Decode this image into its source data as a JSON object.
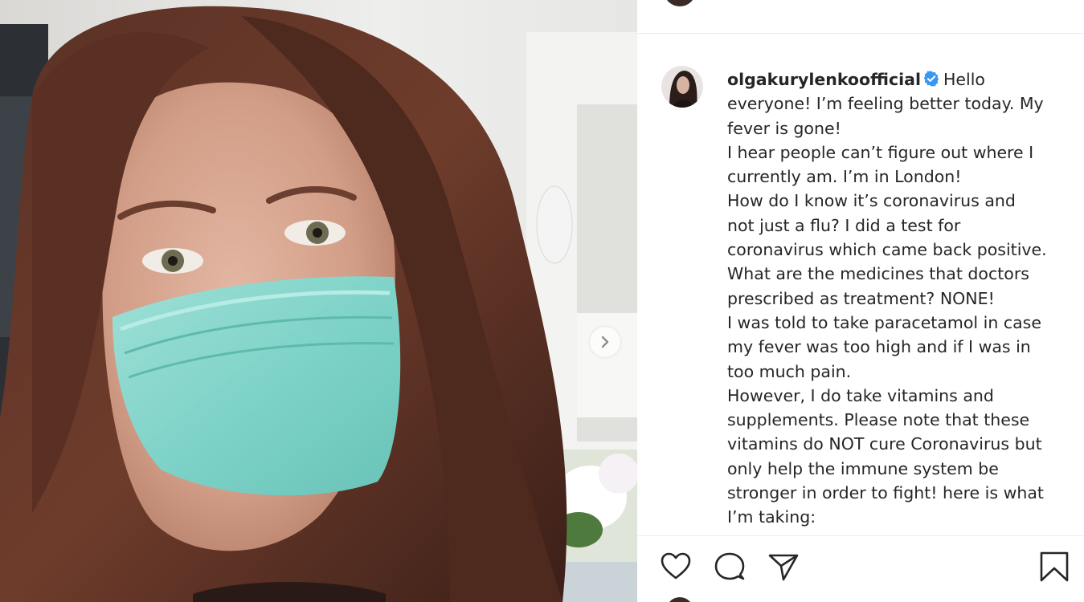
{
  "post": {
    "username": "olgakurylenkoofficial",
    "verified_icon": "verified-badge-icon",
    "caption_lines": [
      "Hello",
      "everyone! I’m feeling better today. My",
      "fever is gone!",
      "I hear people can’t figure out where I",
      "currently am. I’m in London!",
      "How do I know it’s coronavirus and",
      "not just a flu? I did a test for",
      "coronavirus which came back positive.",
      "What are the medicines that doctors",
      "prescribed as treatment? NONE!",
      "I was told to take paracetamol in case",
      "my fever was too high and if I was in",
      "too much pain.",
      "However, I do take vitamins and",
      "supplements. Please note that these",
      "vitamins do NOT cure Coronavirus but",
      "only help the immune system be",
      "stronger in order to fight! here is what",
      "I’m taking:"
    ]
  },
  "actions": {
    "icons": [
      "heart-icon",
      "comment-icon",
      "share-icon",
      "bookmark-icon"
    ]
  },
  "colors": {
    "text": "#262626",
    "verified": "#3897f0",
    "divider": "#ececec"
  }
}
